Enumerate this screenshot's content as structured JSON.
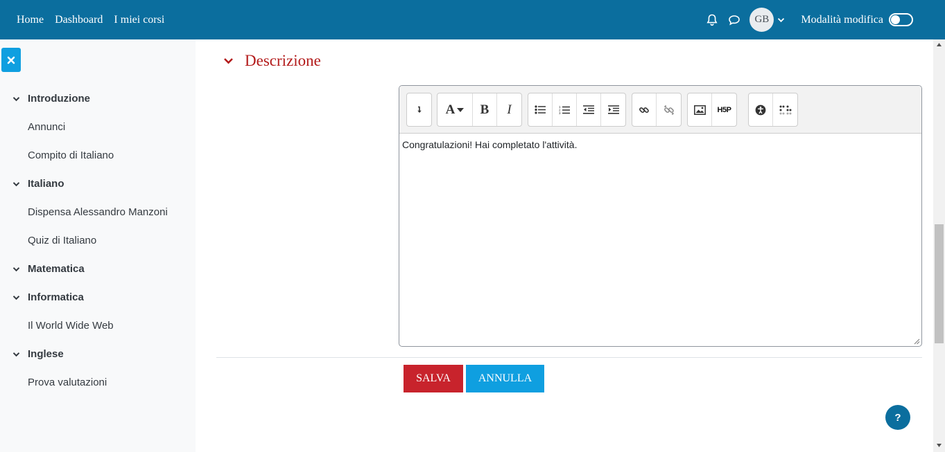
{
  "navbar": {
    "links": [
      "Home",
      "Dashboard",
      "I miei corsi"
    ],
    "avatar_initials": "GB",
    "edit_mode_label": "Modalità modifica",
    "edit_mode_on": false,
    "icons": [
      "bell-icon",
      "chat-icon",
      "chevron-down-icon"
    ]
  },
  "course_index": [
    {
      "label": "Introduzione",
      "items": [
        "Annunci",
        "Compito di Italiano"
      ]
    },
    {
      "label": "Italiano",
      "items": [
        "Dispensa Alessandro Manzoni",
        "Quiz di Italiano"
      ]
    },
    {
      "label": "Matematica",
      "items": []
    },
    {
      "label": "Informatica",
      "items": [
        "Il World Wide Web"
      ]
    },
    {
      "label": "Inglese",
      "items": [
        "Prova valutazioni"
      ]
    }
  ],
  "section": {
    "title": "Descrizione"
  },
  "editor": {
    "content": "Congratulazioni! Hai completato l'attività.",
    "toolbar_glyphs": {
      "bold": "B",
      "italic": "I",
      "font": "A",
      "h5p": "H5P"
    }
  },
  "buttons": {
    "save": "SALVA",
    "cancel": "ANNULLA"
  },
  "help": {
    "label": "?"
  },
  "colors": {
    "navbar": "#0b6e9e",
    "accent": "#0f9fe0",
    "danger": "#c8232c",
    "section_title": "#b31b1b"
  }
}
